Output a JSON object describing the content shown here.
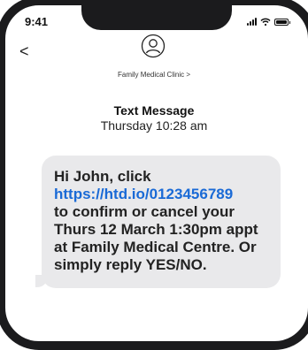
{
  "status_bar": {
    "time": "9:41"
  },
  "nav": {
    "back_icon": "<",
    "contact_name": "Family Medical Clinic >"
  },
  "thread_header": {
    "title": "Text Message",
    "timestamp": "Thursday 10:28 am"
  },
  "message": {
    "lines": [
      "Hi John, click",
      "https://htd.io/0123456789",
      "to confirm or cancel your",
      "Thurs 12 March 1:30pm appt",
      "at Family Medical Centre. Or",
      "simply reply YES/NO."
    ],
    "link": "https://htd.io/0123456789"
  },
  "colors": {
    "bubble_bg": "#e9e9eb",
    "link": "#1a6ad6",
    "frame": "#1b1b1d"
  }
}
